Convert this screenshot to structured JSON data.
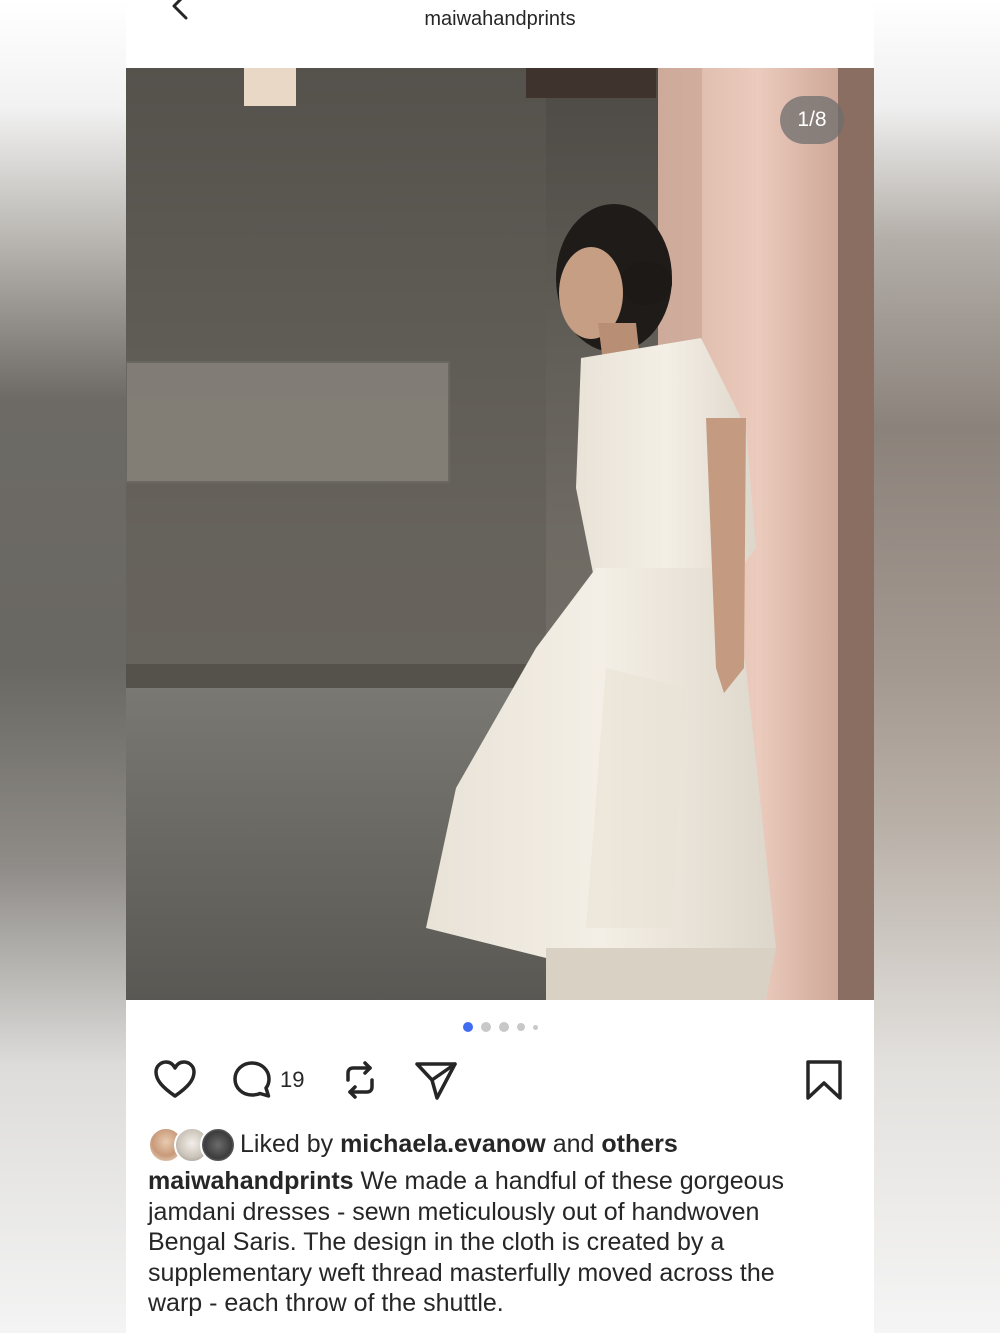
{
  "header": {
    "account_name": "maiwahandprints",
    "back_icon": "chevron-left-icon"
  },
  "post": {
    "image_counter": "1/8",
    "carousel_active_index": 1,
    "carousel_visible_dots": 5
  },
  "actions": {
    "like_icon": "heart-icon",
    "comment_icon": "comment-bubble-icon",
    "comment_count": "19",
    "repost_icon": "repost-icon",
    "share_icon": "send-icon",
    "save_icon": "bookmark-icon"
  },
  "likes": {
    "prefix": "Liked by",
    "user": "michaela.evanow",
    "connector": "and",
    "others": "others"
  },
  "caption": {
    "author": "maiwahandprints",
    "line1": "We made a handful of these gorgeous",
    "line2": "jamdani dresses - sewn meticulously out of handwoven",
    "line3": "Bengal Saris. The design in the cloth is created by a",
    "line4": "supplementary weft thread masterfully moved across the",
    "line5": "warp - each throw of the shuttle."
  },
  "colors": {
    "accent_dot": "#3f6cf0",
    "text": "#262626"
  }
}
